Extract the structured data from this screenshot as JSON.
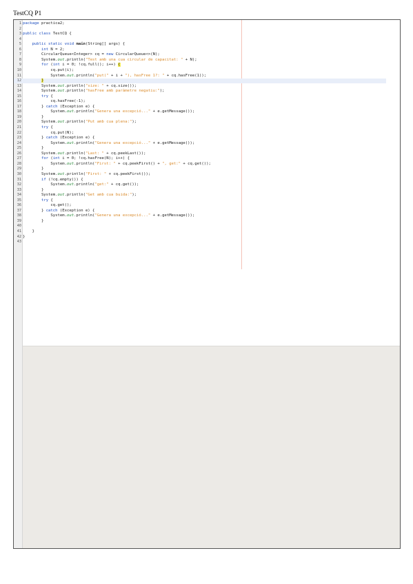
{
  "document": {
    "title": "TestCQ P1"
  },
  "code_lines": [
    {
      "n": "1",
      "segs": [
        {
          "t": "package",
          "c": "kw"
        },
        {
          "t": " practica2;"
        }
      ]
    },
    {
      "n": "2",
      "segs": []
    },
    {
      "n": "3",
      "segs": [
        {
          "t": "public class",
          "c": "kw"
        },
        {
          "t": " TestCQ {"
        }
      ]
    },
    {
      "n": "4",
      "segs": []
    },
    {
      "n": "5",
      "segs": [
        {
          "t": "    "
        },
        {
          "t": "public static void",
          "c": "kw"
        },
        {
          "t": " "
        },
        {
          "t": "main",
          "c": "bold"
        },
        {
          "t": "(String[] args) {"
        }
      ]
    },
    {
      "n": "6",
      "segs": [
        {
          "t": "        "
        },
        {
          "t": "int",
          "c": "kw"
        },
        {
          "t": " N = 2;"
        }
      ]
    },
    {
      "n": "7",
      "segs": [
        {
          "t": "        CircularQueue<Integer> cq = "
        },
        {
          "t": "new",
          "c": "kw"
        },
        {
          "t": " CircularQueue<>(N);"
        }
      ]
    },
    {
      "n": "8",
      "segs": [
        {
          "t": "        System."
        },
        {
          "t": "out",
          "c": "fld"
        },
        {
          "t": ".println("
        },
        {
          "t": "\"Test amb una cua circular de capacitat: \"",
          "c": "str"
        },
        {
          "t": " + N);"
        }
      ]
    },
    {
      "n": "9",
      "segs": [
        {
          "t": "        "
        },
        {
          "t": "for",
          "c": "kw"
        },
        {
          "t": " ("
        },
        {
          "t": "int",
          "c": "kw"
        },
        {
          "t": " i = 0; !cq.full(); i++) "
        },
        {
          "t": "{",
          "c": "brace"
        }
      ]
    },
    {
      "n": "10",
      "segs": [
        {
          "t": "            cq.put(i);"
        }
      ]
    },
    {
      "n": "11",
      "segs": [
        {
          "t": "            System."
        },
        {
          "t": "out",
          "c": "fld"
        },
        {
          "t": ".println("
        },
        {
          "t": "\"put(\"",
          "c": "str"
        },
        {
          "t": " + i + "
        },
        {
          "t": "\"), hasFree 1?: \"",
          "c": "str"
        },
        {
          "t": " + cq.hasFree(1));"
        }
      ]
    },
    {
      "n": "12",
      "current": true,
      "segs": [
        {
          "t": "        "
        },
        {
          "t": "}",
          "c": "brace"
        }
      ]
    },
    {
      "n": "13",
      "segs": [
        {
          "t": "        System."
        },
        {
          "t": "out",
          "c": "fld"
        },
        {
          "t": ".println("
        },
        {
          "t": "\"size: \"",
          "c": "str"
        },
        {
          "t": " + cq.size());"
        }
      ]
    },
    {
      "n": "14",
      "segs": [
        {
          "t": "        System."
        },
        {
          "t": "out",
          "c": "fld"
        },
        {
          "t": ".println("
        },
        {
          "t": "\"hasFree amb paràmetre negatiu:\"",
          "c": "str"
        },
        {
          "t": ");"
        }
      ]
    },
    {
      "n": "15",
      "segs": [
        {
          "t": "        "
        },
        {
          "t": "try",
          "c": "kw"
        },
        {
          "t": " {"
        }
      ]
    },
    {
      "n": "16",
      "segs": [
        {
          "t": "            cq.hasFree(-1);"
        }
      ]
    },
    {
      "n": "17",
      "segs": [
        {
          "t": "        } "
        },
        {
          "t": "catch",
          "c": "kw"
        },
        {
          "t": " (Exception e) {"
        }
      ]
    },
    {
      "n": "18",
      "segs": [
        {
          "t": "            System."
        },
        {
          "t": "out",
          "c": "fld"
        },
        {
          "t": ".println("
        },
        {
          "t": "\"Genera una excepció...\"",
          "c": "str"
        },
        {
          "t": " + e.getMessage());"
        }
      ]
    },
    {
      "n": "19",
      "segs": [
        {
          "t": "        }"
        }
      ]
    },
    {
      "n": "20",
      "segs": [
        {
          "t": "        System."
        },
        {
          "t": "out",
          "c": "fld"
        },
        {
          "t": ".println("
        },
        {
          "t": "\"Put amb cua plena:\"",
          "c": "str"
        },
        {
          "t": ");"
        }
      ]
    },
    {
      "n": "21",
      "segs": [
        {
          "t": "        "
        },
        {
          "t": "try",
          "c": "kw"
        },
        {
          "t": " {"
        }
      ]
    },
    {
      "n": "22",
      "segs": [
        {
          "t": "            cq.put(N);"
        }
      ]
    },
    {
      "n": "23",
      "segs": [
        {
          "t": "        } "
        },
        {
          "t": "catch",
          "c": "kw"
        },
        {
          "t": " (Exception e) {"
        }
      ]
    },
    {
      "n": "24",
      "segs": [
        {
          "t": "            System."
        },
        {
          "t": "out",
          "c": "fld"
        },
        {
          "t": ".println("
        },
        {
          "t": "\"Genera una excepció...\"",
          "c": "str"
        },
        {
          "t": " + e.getMessage());"
        }
      ]
    },
    {
      "n": "25",
      "segs": [
        {
          "t": "        }"
        }
      ]
    },
    {
      "n": "26",
      "segs": [
        {
          "t": "        System."
        },
        {
          "t": "out",
          "c": "fld"
        },
        {
          "t": ".println("
        },
        {
          "t": "\"Last: \"",
          "c": "str"
        },
        {
          "t": " + cq.peekLast());"
        }
      ]
    },
    {
      "n": "27",
      "segs": [
        {
          "t": "        "
        },
        {
          "t": "for",
          "c": "kw"
        },
        {
          "t": " ("
        },
        {
          "t": "int",
          "c": "kw"
        },
        {
          "t": " i = 0; !cq.hasFree(N); i++) {"
        }
      ]
    },
    {
      "n": "28",
      "segs": [
        {
          "t": "            System."
        },
        {
          "t": "out",
          "c": "fld"
        },
        {
          "t": ".println("
        },
        {
          "t": "\"First: \"",
          "c": "str"
        },
        {
          "t": " + cq.peekFirst() + "
        },
        {
          "t": "\", get:\"",
          "c": "str"
        },
        {
          "t": " + cq.get());"
        }
      ]
    },
    {
      "n": "29",
      "segs": [
        {
          "t": "        }"
        }
      ]
    },
    {
      "n": "30",
      "segs": [
        {
          "t": "        System."
        },
        {
          "t": "out",
          "c": "fld"
        },
        {
          "t": ".println("
        },
        {
          "t": "\"First: \"",
          "c": "str"
        },
        {
          "t": " + cq.peekFirst());"
        }
      ]
    },
    {
      "n": "31",
      "segs": [
        {
          "t": "        "
        },
        {
          "t": "if",
          "c": "kw"
        },
        {
          "t": " (!cq.empty()) {"
        }
      ]
    },
    {
      "n": "32",
      "segs": [
        {
          "t": "            System."
        },
        {
          "t": "out",
          "c": "fld"
        },
        {
          "t": ".println("
        },
        {
          "t": "\"get:\"",
          "c": "str"
        },
        {
          "t": " + cq.get());"
        }
      ]
    },
    {
      "n": "33",
      "segs": [
        {
          "t": "        }"
        }
      ]
    },
    {
      "n": "34",
      "segs": [
        {
          "t": "        System."
        },
        {
          "t": "out",
          "c": "fld"
        },
        {
          "t": ".println("
        },
        {
          "t": "\"Get amb cua buida:\"",
          "c": "str"
        },
        {
          "t": ");"
        }
      ]
    },
    {
      "n": "35",
      "segs": [
        {
          "t": "        "
        },
        {
          "t": "try",
          "c": "kw"
        },
        {
          "t": " {"
        }
      ]
    },
    {
      "n": "36",
      "segs": [
        {
          "t": "            cq.get();"
        }
      ]
    },
    {
      "n": "37",
      "segs": [
        {
          "t": "        } "
        },
        {
          "t": "catch",
          "c": "kw"
        },
        {
          "t": " (Exception e) {"
        }
      ]
    },
    {
      "n": "38",
      "segs": [
        {
          "t": "            System."
        },
        {
          "t": "out",
          "c": "fld"
        },
        {
          "t": ".println("
        },
        {
          "t": "\"Genera una excepció...\"",
          "c": "str"
        },
        {
          "t": " + e.getMessage());"
        }
      ]
    },
    {
      "n": "39",
      "segs": [
        {
          "t": "        }"
        }
      ]
    },
    {
      "n": "40",
      "segs": []
    },
    {
      "n": "41",
      "segs": [
        {
          "t": "    }"
        }
      ]
    },
    {
      "n": "42",
      "segs": [
        {
          "t": "}"
        }
      ]
    },
    {
      "n": "43",
      "segs": []
    }
  ],
  "colors": {
    "keyword": "#1f4fbf",
    "string": "#d98a2b",
    "field": "#2a8a3a",
    "brace_highlight": "#f7ef55",
    "current_line": "#e8eef9"
  }
}
